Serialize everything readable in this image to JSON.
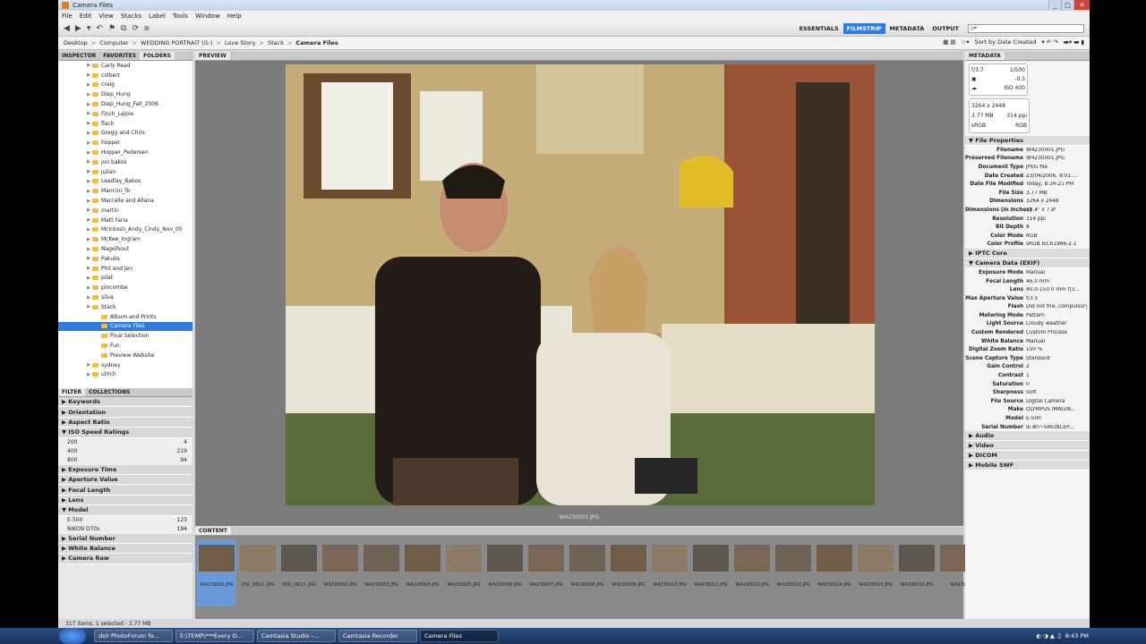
{
  "window": {
    "title": "Camera Files"
  },
  "menu": [
    "File",
    "Edit",
    "View",
    "Stacks",
    "Label",
    "Tools",
    "Window",
    "Help"
  ],
  "workspaces": [
    {
      "label": "ESSENTIALS",
      "active": false
    },
    {
      "label": "FILMSTRIP",
      "active": true
    },
    {
      "label": "METADATA",
      "active": false
    },
    {
      "label": "OUTPUT",
      "active": false
    }
  ],
  "search": {
    "placeholder": "ρ▾"
  },
  "path": [
    "Desktop",
    "Computer",
    "WEDDING PORTRAIT (G:)",
    "Love Story",
    "Stack",
    "Camera Files"
  ],
  "sort": {
    "label": "Sort by Date Created"
  },
  "left_tabs": [
    "INSPECTOR",
    "FAVORITES",
    "FOLDERS"
  ],
  "folders": [
    {
      "label": "Carly Read",
      "indent": 0
    },
    {
      "label": "colbert",
      "indent": 0
    },
    {
      "label": "craig",
      "indent": 0
    },
    {
      "label": "Diep_Hung",
      "indent": 0
    },
    {
      "label": "Diep_Hung_Fall_2006",
      "indent": 0
    },
    {
      "label": "Finch_Lajoie",
      "indent": 0
    },
    {
      "label": "flach",
      "indent": 0
    },
    {
      "label": "Gregg and Chris",
      "indent": 0
    },
    {
      "label": "hopper",
      "indent": 0
    },
    {
      "label": "Hopper_Pedersen",
      "indent": 0
    },
    {
      "label": "jon bakos",
      "indent": 0
    },
    {
      "label": "julian",
      "indent": 0
    },
    {
      "label": "Leadlay_Bakos",
      "indent": 0
    },
    {
      "label": "Mancini_To",
      "indent": 0
    },
    {
      "label": "Marcelle and Allana",
      "indent": 0
    },
    {
      "label": "martin",
      "indent": 0
    },
    {
      "label": "Matt Faria",
      "indent": 0
    },
    {
      "label": "McIntosh_Andy_Cindy_Nov_05",
      "indent": 0
    },
    {
      "label": "McKee_Ingram",
      "indent": 0
    },
    {
      "label": "Nagelhout",
      "indent": 0
    },
    {
      "label": "Pakulis",
      "indent": 0
    },
    {
      "label": "Phil and Jen",
      "indent": 0
    },
    {
      "label": "pilat",
      "indent": 0
    },
    {
      "label": "pincombe",
      "indent": 0
    },
    {
      "label": "silva",
      "indent": 0
    },
    {
      "label": "Stack",
      "indent": 0
    },
    {
      "label": "Album and Prints",
      "indent": 1
    },
    {
      "label": "Camera Files",
      "indent": 1,
      "selected": true
    },
    {
      "label": "Final Selection",
      "indent": 1
    },
    {
      "label": "Fun",
      "indent": 1
    },
    {
      "label": "Preview Website",
      "indent": 1
    },
    {
      "label": "sydney",
      "indent": 0
    },
    {
      "label": "ulrich",
      "indent": 0
    }
  ],
  "filter_tabs": [
    "FILTER",
    "COLLECTIONS"
  ],
  "filters": [
    {
      "label": "Keywords"
    },
    {
      "label": "Orientation"
    },
    {
      "label": "Aspect Ratio"
    },
    {
      "label": "ISO Speed Ratings",
      "open": true,
      "values": [
        {
          "k": "200",
          "n": "4"
        },
        {
          "k": "400",
          "n": "219"
        },
        {
          "k": "800",
          "n": "94"
        }
      ]
    },
    {
      "label": "Exposure Time"
    },
    {
      "label": "Aperture Value"
    },
    {
      "label": "Focal Length"
    },
    {
      "label": "Lens"
    },
    {
      "label": "Model",
      "open": true,
      "values": [
        {
          "k": "E-500",
          "n": "123"
        },
        {
          "k": "NIKON D70s",
          "n": "194"
        }
      ]
    },
    {
      "label": "Serial Number"
    },
    {
      "label": "White Balance"
    },
    {
      "label": "Camera Raw"
    }
  ],
  "preview": {
    "tab": "PREVIEW",
    "filename": "W4230001.JPG"
  },
  "content": {
    "tab": "CONTENT",
    "thumbs": [
      "W4230001.JPG",
      "DSC_0612 .JPG",
      "DSC_0613 .JPG",
      "W4230002.JPG",
      "W4230003.JPG",
      "W4230004.JPG",
      "W4230005.JPG",
      "W4230006.JPG",
      "W4230007.JPG",
      "W4230008.JPG",
      "W4230009.JPG",
      "W4230010.JPG",
      "W4230011.JPG",
      "W4230012.JPG",
      "W4230013.JPG",
      "W4230014.JPG",
      "W4230015.JPG",
      "W4230016.JPG",
      "W4230"
    ]
  },
  "status": {
    "text": "317 items, 1 selected - 3.77 MB"
  },
  "metadata": {
    "tab": "METADATA",
    "summary": {
      "aperture": "f/3.7",
      "shutter": "1/500",
      "ev": "-0.3",
      "iso": "ISO 400",
      "dims": "3264 x 2448",
      "size": "3.77 MB",
      "ppi": "314 ppi",
      "profile": "sRGB",
      "mode": "RGB"
    },
    "sections": [
      {
        "title": "File Properties",
        "rows": [
          [
            "Filename",
            "W4230001.JPG"
          ],
          [
            "Preserved Filename",
            "W4230001.JPG"
          ],
          [
            "Document Type",
            "JPEG file"
          ],
          [
            "Date Created",
            "23/04/2006, 8:01:..."
          ],
          [
            "Date File Modified",
            "Today, 8:34:21 PM"
          ],
          [
            "File Size",
            "3.77 MB"
          ],
          [
            "Dimensions",
            "3264 x 2448"
          ],
          [
            "Dimensions (in inches)",
            "10.4\" x 7.8\""
          ],
          [
            "Resolution",
            "314 ppi"
          ],
          [
            "Bit Depth",
            "8"
          ],
          [
            "Color Mode",
            "RGB"
          ],
          [
            "Color Profile",
            "sRGB IEC61966-2.1"
          ]
        ]
      },
      {
        "title": "IPTC Core",
        "rows": []
      },
      {
        "title": "Camera Data (EXIF)",
        "rows": [
          [
            "Exposure Mode",
            "Manual"
          ],
          [
            "Focal Length",
            "46.0 mm"
          ],
          [
            "Lens",
            "40.0-150.0 mm f/3..."
          ],
          [
            "Max Aperture Value",
            "f/3.5"
          ],
          [
            "Flash",
            "Did not fire, compulsory mode"
          ],
          [
            "Metering Mode",
            "Pattern"
          ],
          [
            "Light Source",
            "Cloudy weather"
          ],
          [
            "Custom Rendered",
            "Custom Process"
          ],
          [
            "White Balance",
            "Manual"
          ],
          [
            "Digital Zoom Ratio",
            "100 %"
          ],
          [
            "Scene Capture Type",
            "Standard"
          ],
          [
            "Gain Control",
            "2"
          ],
          [
            "Contrast",
            "1"
          ],
          [
            "Saturation",
            "0"
          ],
          [
            "Sharpness",
            "Soft"
          ],
          [
            "File Source",
            "Digital Camera"
          ],
          [
            "Make",
            "OLYMPUS IMAGIN..."
          ],
          [
            "Model",
            "E-500"
          ],
          [
            "Serial Number",
            "IE-Bn~SIRÖ$CEP..."
          ]
        ]
      },
      {
        "title": "Audio",
        "rows": []
      },
      {
        "title": "Video",
        "rows": []
      },
      {
        "title": "DICOM",
        "rows": []
      },
      {
        "title": "Mobile SWF",
        "rows": []
      }
    ]
  },
  "taskbar": {
    "tasks": [
      {
        "label": "dslr PhotoForum fo...",
        "active": false
      },
      {
        "label": "E:\\TEMP\\***Every D...",
        "active": false
      },
      {
        "label": "Camtasia Studio -...",
        "active": false
      },
      {
        "label": "Camtasia Recorder",
        "active": false
      },
      {
        "label": "Camera Files",
        "active": true
      }
    ],
    "clock": "8:43 PM"
  }
}
